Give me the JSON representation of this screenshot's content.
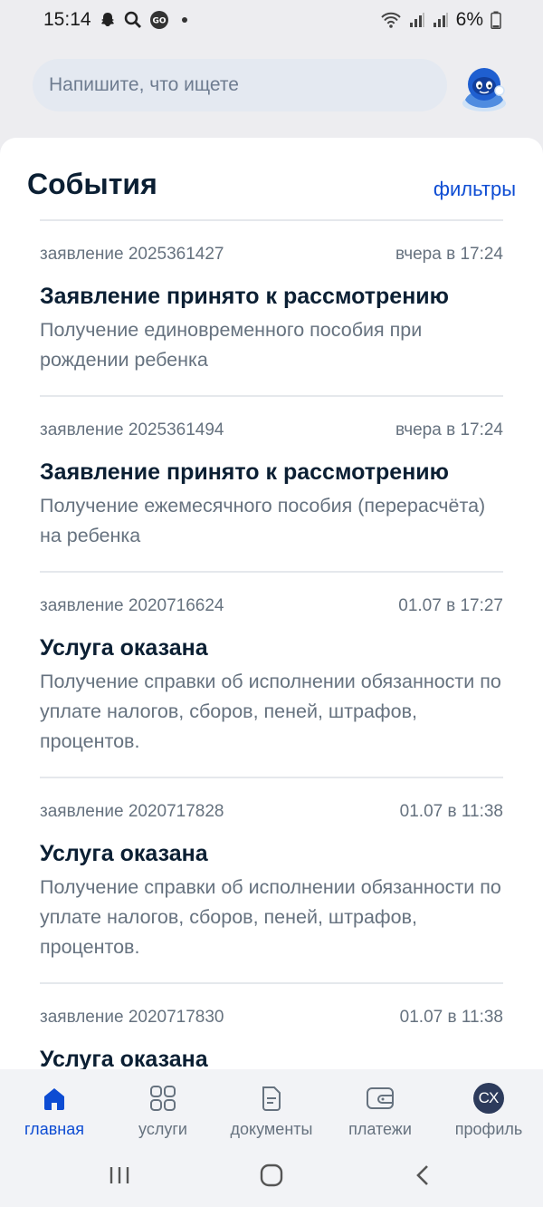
{
  "status_bar": {
    "time": "15:14",
    "left_icons": [
      "snapchat-icon",
      "search-icon",
      "go-icon"
    ],
    "battery": "6%"
  },
  "search": {
    "placeholder": "Напишите, что ищете"
  },
  "events": {
    "title": "События",
    "filters_label": "фильтры",
    "items": [
      {
        "number": "заявление 2025361427",
        "time": "вчера в 17:24",
        "status": "Заявление принято к рассмотрению",
        "description": "Получение единовременного пособия при рождении ребенка"
      },
      {
        "number": "заявление 2025361494",
        "time": "вчера в 17:24",
        "status": "Заявление принято к рассмотрению",
        "description": "Получение ежемесячного пособия (перерасчёта) на ребенка"
      },
      {
        "number": "заявление 2020716624",
        "time": "01.07 в 17:27",
        "status": "Услуга оказана",
        "description": "Получение справки об исполнении обязанности по уплате налогов, сборов, пеней, штрафов, процентов."
      },
      {
        "number": "заявление 2020717828",
        "time": "01.07 в 11:38",
        "status": "Услуга оказана",
        "description": "Получение справки об исполнении обязанности по уплате налогов, сборов, пеней, штрафов, процентов."
      },
      {
        "number": "заявление 2020717830",
        "time": "01.07 в 11:38",
        "status": "Услуга оказана",
        "description": ""
      }
    ]
  },
  "bottom_nav": {
    "items": [
      {
        "label": "главная",
        "icon": "home-icon"
      },
      {
        "label": "услуги",
        "icon": "grid-icon"
      },
      {
        "label": "документы",
        "icon": "document-icon"
      },
      {
        "label": "платежи",
        "icon": "wallet-icon"
      },
      {
        "label": "профиль",
        "icon": "avatar"
      }
    ],
    "avatar_initials": "СХ"
  },
  "colors": {
    "accent": "#0d4cd3",
    "text": "#0b1f33",
    "muted": "#66727f"
  }
}
